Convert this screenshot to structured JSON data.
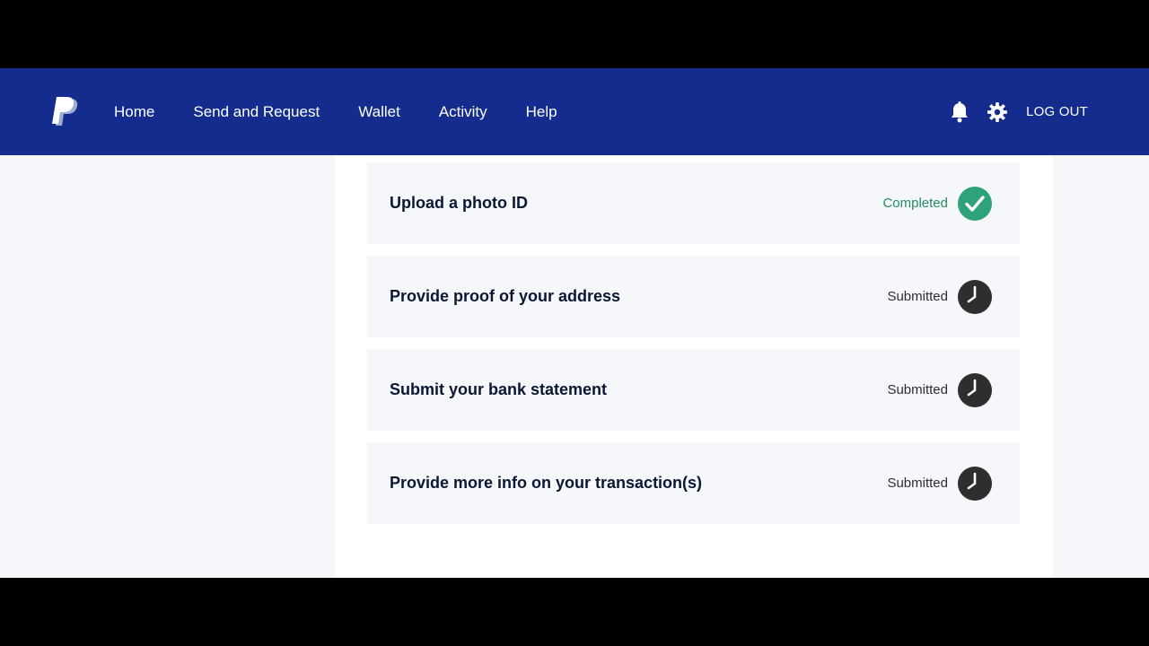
{
  "navbar": {
    "logo_icon": "paypal-logo-icon",
    "links": [
      "Home",
      "Send and Request",
      "Wallet",
      "Activity",
      "Help"
    ],
    "notifications_icon": "bell-icon",
    "settings_icon": "gear-icon",
    "logout_label": "LOG OUT",
    "background_color": "#142c8e"
  },
  "tasks": [
    {
      "title": "Upload a photo ID",
      "status": "Completed",
      "icon": "check-circle-icon",
      "status_color": "#248c64"
    },
    {
      "title": "Provide proof of your address",
      "status": "Submitted",
      "icon": "clock-icon",
      "status_color": "#2c2e2f"
    },
    {
      "title": "Submit your bank statement",
      "status": "Submitted",
      "icon": "clock-icon",
      "status_color": "#2c2e2f"
    },
    {
      "title": "Provide more info on your transaction(s)",
      "status": "Submitted",
      "icon": "clock-icon",
      "status_color": "#2c2e2f"
    }
  ]
}
